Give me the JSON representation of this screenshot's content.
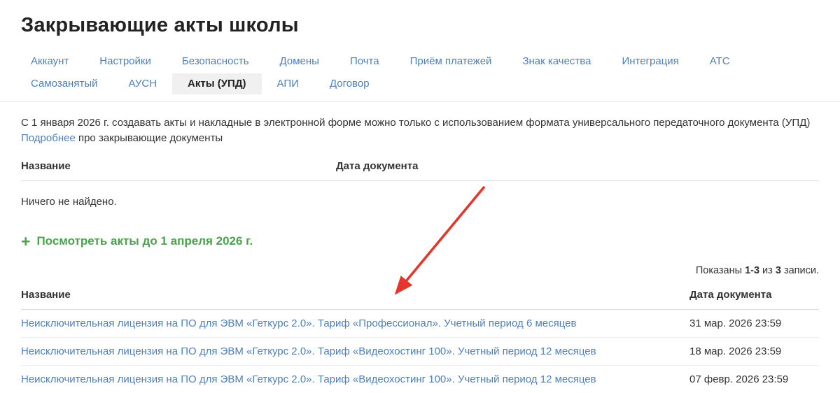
{
  "page": {
    "title": "Закрывающие акты школы"
  },
  "tabs": {
    "items": [
      {
        "label": "Аккаунт",
        "active": false
      },
      {
        "label": "Настройки",
        "active": false
      },
      {
        "label": "Безопасность",
        "active": false
      },
      {
        "label": "Домены",
        "active": false
      },
      {
        "label": "Почта",
        "active": false
      },
      {
        "label": "Приём платежей",
        "active": false
      },
      {
        "label": "Знак качества",
        "active": false
      },
      {
        "label": "Интеграция",
        "active": false
      },
      {
        "label": "АТС",
        "active": false
      },
      {
        "label": "Самозанятый",
        "active": false
      },
      {
        "label": "АУСН",
        "active": false
      },
      {
        "label": "Акты (УПД)",
        "active": true
      },
      {
        "label": "АПИ",
        "active": false
      },
      {
        "label": "Договор",
        "active": false
      }
    ]
  },
  "notice": {
    "text": "С 1 января 2026 г. создавать акты и накладные в электронной форме можно только с использованием формата универсального передаточного документа (УПД)",
    "link_label": "Подробнее",
    "link_suffix": " про закрывающие документы"
  },
  "empty_table": {
    "col_name": "Название",
    "col_date": "Дата документа",
    "empty_text": "Ничего не найдено."
  },
  "view_acts": {
    "plus_icon": "+",
    "label": "Посмотреть акты до 1 апреля 2026 г."
  },
  "pagination": {
    "prefix": "Показаны ",
    "range": "1-3",
    "middle": " из ",
    "total": "3",
    "suffix": " записи."
  },
  "acts_table": {
    "col_name": "Название",
    "col_date": "Дата документа",
    "rows": [
      {
        "name": "Неисключительная лицензия на ПО для ЭВМ «Геткурс 2.0». Тариф «Профессионал». Учетный период 6 месяцев",
        "date": "31 мар. 2026 23:59"
      },
      {
        "name": "Неисключительная лицензия на ПО для ЭВМ «Геткурс 2.0». Тариф «Видеохостинг 100». Учетный период 12 месяцев",
        "date": "18 мар. 2026 23:59"
      },
      {
        "name": "Неисключительная лицензия на ПО для ЭВМ «Геткурс 2.0». Тариф «Видеохостинг 100». Учетный период 12 месяцев",
        "date": "07 февр. 2026 23:59"
      }
    ]
  },
  "colors": {
    "link_blue": "#4d80ba",
    "accent_green": "#47a44b",
    "arrow_red": "#e3362c",
    "active_tab_bg": "#f0f0f0"
  }
}
